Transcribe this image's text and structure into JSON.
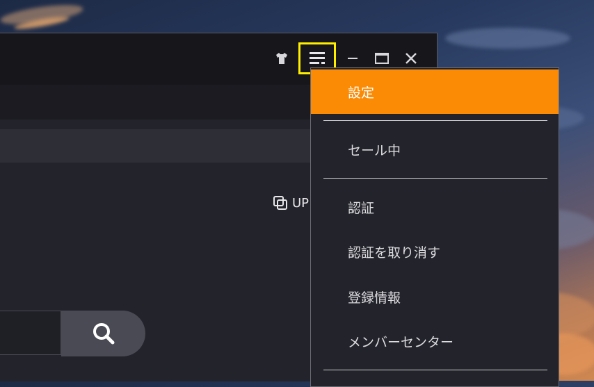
{
  "window": {
    "title_icons": [
      "tshirt-icon",
      "hamburger-menu-icon",
      "minimize-icon",
      "maximize-icon",
      "close-icon"
    ],
    "upgrade_label": "UP",
    "accent_color": "#fb8a04",
    "highlight_color": "#ffee00"
  },
  "menu": {
    "items": [
      {
        "label": "設定",
        "active": true
      },
      {
        "label": "セール中",
        "active": false
      },
      {
        "label": "認証",
        "active": false
      },
      {
        "label": "認証を取り消す",
        "active": false
      },
      {
        "label": "登録情報",
        "active": false
      },
      {
        "label": "メンバーセンター",
        "active": false
      }
    ]
  }
}
